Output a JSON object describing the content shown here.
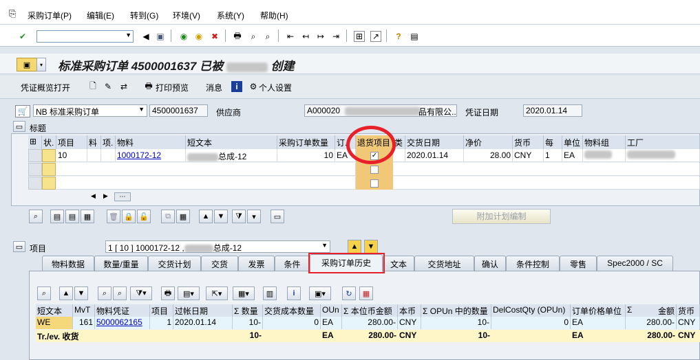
{
  "menu": [
    "采购订单(P)",
    "编辑(E)",
    "转到(G)",
    "环境(V)",
    "系统(Y)",
    "帮助(H)"
  ],
  "title": {
    "prefix": "标准采购订单 4500001637 已被",
    "suffix": "创建"
  },
  "app_toolbar": {
    "overview": "凭证概览打开",
    "print_preview": "打印预览",
    "messages": "消息",
    "personal": "个人设置"
  },
  "header": {
    "doc_type": "NB 标准采购订单",
    "po_number": "4500001637",
    "vendor_label": "供应商",
    "vendor_prefix": "A000020",
    "vendor_suffix": "品有限公...",
    "doc_date_label": "凭证日期",
    "doc_date": "2020.01.14",
    "header_label": "标题"
  },
  "items_table": {
    "columns": [
      "状.",
      "项目",
      "料",
      "项.",
      "物料",
      "短文本",
      "采购订单数量",
      "订.",
      "退货项目",
      "交货日期",
      "净价",
      "货币",
      "每",
      "单位",
      "物料组",
      "工厂"
    ],
    "row": {
      "item": "10",
      "material": "1000172-12",
      "short_text_suffix": "总成-12",
      "qty": "10",
      "unit": "EA",
      "return_checked": "✓",
      "delivery_date": "2020.01.14",
      "net_price": "28.00",
      "currency": "CNY",
      "per": "1",
      "order_unit": "EA"
    },
    "schedule_button": "附加计划编制"
  },
  "item_selector": {
    "label": "项目",
    "value_prefix": "1 [ 10 ] 1000172-12 ,",
    "value_suffix": "总成-12"
  },
  "tabs": [
    "物料数据",
    "数量/重量",
    "交货计划",
    "交货",
    "发票",
    "条件",
    "采购订单历史",
    "文本",
    "交货地址",
    "确认",
    "条件控制",
    "零售",
    "Spec2000 / SC"
  ],
  "history": {
    "columns": [
      "短文本",
      "MvT",
      "物料凭证",
      "项目",
      "过帐日期",
      "数量",
      "交货成本数量",
      "OUn",
      "本位币金额",
      "本币",
      "OPUn 中的数量",
      "DelCostQty (OPUn)",
      "订单价格单位",
      "金额",
      "货币"
    ],
    "row": {
      "short": "WE",
      "mvt": "161",
      "doc": "5000062165",
      "item": "1",
      "date": "2020.01.14",
      "qty": "10-",
      "dcq": "0",
      "oun": "EA",
      "amount": "280.00-",
      "cur": "CNY",
      "opun_qty": "10-",
      "delcost": "0",
      "opu": "EA",
      "amount2": "280.00-",
      "cur2": "CNY"
    },
    "sum": {
      "label": "Tr./ev. 收货",
      "qty": "10-",
      "oun": "EA",
      "amount": "280.00-",
      "cur": "CNY",
      "opun_qty": "10-",
      "opu": "EA",
      "amount2": "280.00-",
      "cur2": "CNY"
    }
  }
}
